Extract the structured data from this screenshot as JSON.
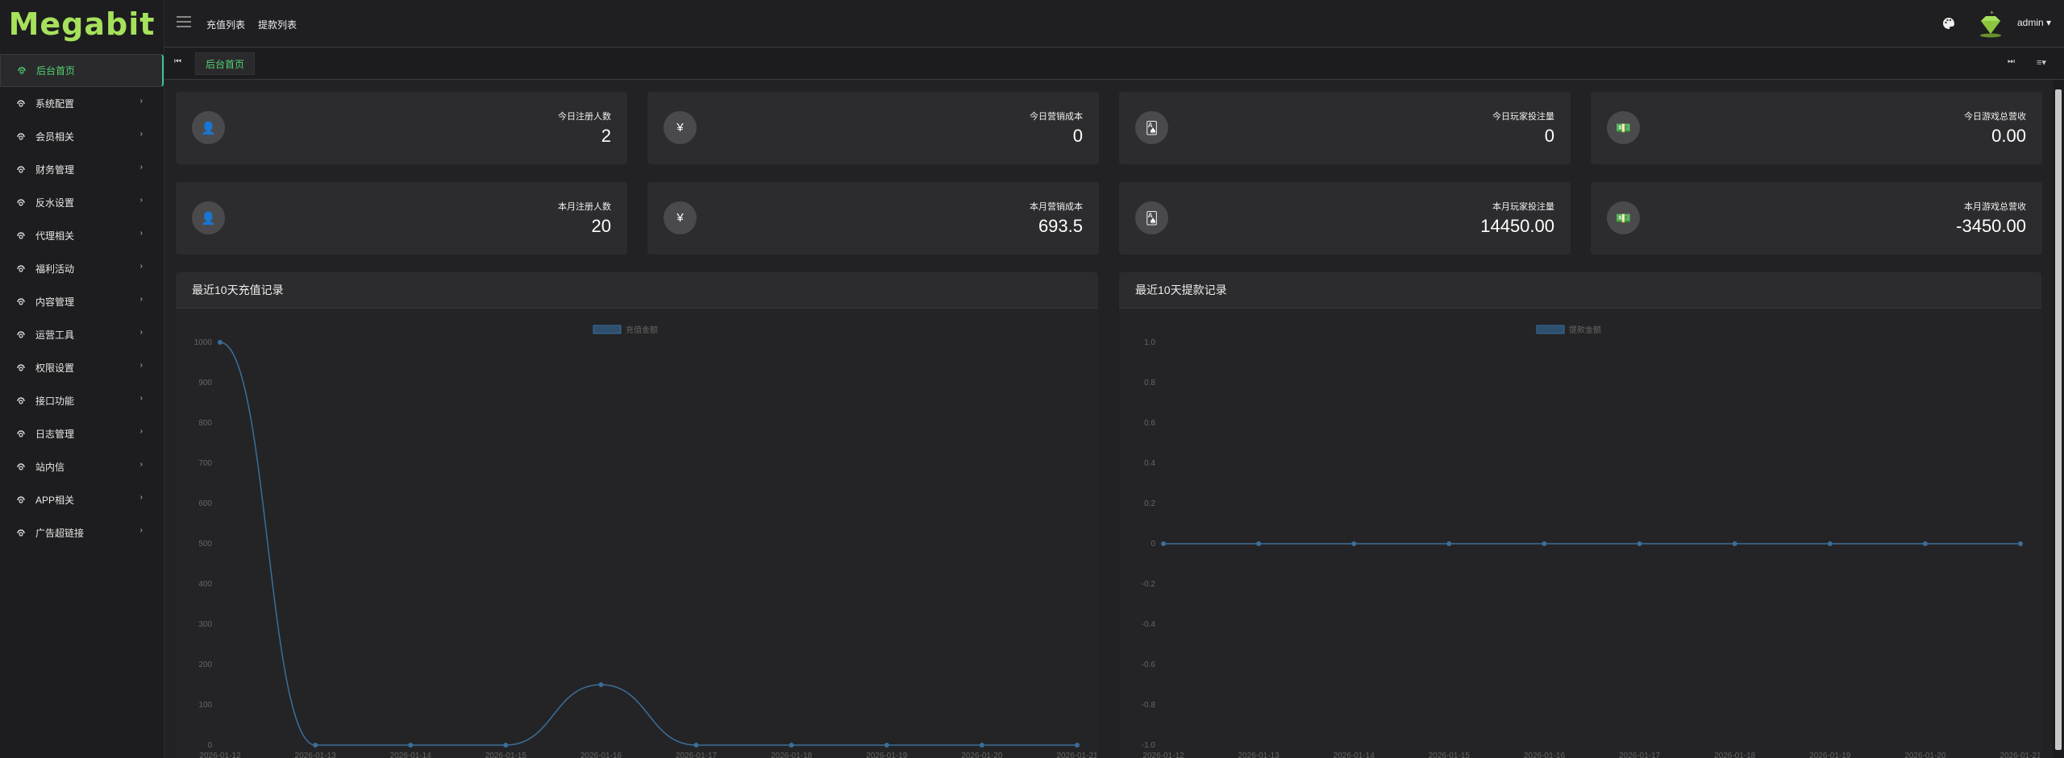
{
  "app": {
    "logo": "Megabit"
  },
  "sidebar": {
    "items": [
      {
        "label": "后台首页",
        "active": true,
        "arrow": ""
      },
      {
        "label": "系统配置",
        "arrow": "›"
      },
      {
        "label": "会员相关",
        "arrow": "›"
      },
      {
        "label": "财务管理",
        "arrow": "›"
      },
      {
        "label": "反水设置",
        "arrow": "›"
      },
      {
        "label": "代理相关",
        "arrow": "›"
      },
      {
        "label": "福利活动",
        "arrow": "›"
      },
      {
        "label": "内容管理",
        "arrow": "›"
      },
      {
        "label": "运营工具",
        "arrow": "›"
      },
      {
        "label": "权限设置",
        "arrow": "›"
      },
      {
        "label": "接口功能",
        "arrow": "›"
      },
      {
        "label": "日志管理",
        "arrow": "›"
      },
      {
        "label": "站内信",
        "arrow": "›"
      },
      {
        "label": "APP相关",
        "arrow": "›"
      },
      {
        "label": "广告超链接",
        "arrow": "›"
      }
    ]
  },
  "topbar": {
    "links": [
      "充值列表",
      "提款列表"
    ],
    "user": "admin ▾"
  },
  "tabs": {
    "active": "后台首页",
    "left_icon": "⏮",
    "right_icon1": "⏭",
    "right_icon2": "≡▾"
  },
  "stats": [
    {
      "label": "今日注册人数",
      "value": "2",
      "icon": "user-icon",
      "glyph": "👤"
    },
    {
      "label": "今日营销成本",
      "value": "0",
      "icon": "yen-icon",
      "glyph": "¥"
    },
    {
      "label": "今日玩家投注量",
      "value": "0",
      "icon": "cards-icon",
      "glyph": "🂡"
    },
    {
      "label": "今日游戏总营收",
      "value": "0.00",
      "icon": "money-icon",
      "glyph": "💵"
    },
    {
      "label": "本月注册人数",
      "value": "20",
      "icon": "user-icon",
      "glyph": "👤"
    },
    {
      "label": "本月营销成本",
      "value": "693.5",
      "icon": "yen-icon",
      "glyph": "¥"
    },
    {
      "label": "本月玩家投注量",
      "value": "14450.00",
      "icon": "cards-icon",
      "glyph": "🂡"
    },
    {
      "label": "本月游戏总营收",
      "value": "-3450.00",
      "icon": "money-icon",
      "glyph": "💵"
    }
  ],
  "panels": {
    "recharge_title": "最近10天充值记录",
    "withdraw_title": "最近10天提款记录"
  },
  "chart_data": [
    {
      "type": "line",
      "legend": "充值金额",
      "x": [
        "2026-01-12",
        "2026-01-13",
        "2026-01-14",
        "2026-01-15",
        "2026-01-16",
        "2026-01-17",
        "2026-01-18",
        "2026-01-19",
        "2026-01-20",
        "2026-01-21"
      ],
      "values": [
        1000,
        0,
        0,
        0,
        150,
        0,
        0,
        0,
        0,
        0
      ],
      "ylim": [
        0,
        1000
      ],
      "yticks": [
        0,
        100,
        200,
        300,
        400,
        500,
        600,
        700,
        800,
        900,
        1000
      ],
      "color": "#3b6e9a"
    },
    {
      "type": "line",
      "legend": "提款金额",
      "x": [
        "2026-01-12",
        "2026-01-13",
        "2026-01-14",
        "2026-01-15",
        "2026-01-16",
        "2026-01-17",
        "2026-01-18",
        "2026-01-19",
        "2026-01-20",
        "2026-01-21"
      ],
      "values": [
        0,
        0,
        0,
        0,
        0,
        0,
        0,
        0,
        0,
        0
      ],
      "ylim": [
        -1.0,
        1.0
      ],
      "yticks": [
        "-1.0",
        "-0.8",
        "-0.6",
        "-0.4",
        "-0.2",
        "0",
        "0.2",
        "0.4",
        "0.6",
        "0.8",
        "1.0"
      ],
      "color": "#3b6e9a"
    }
  ]
}
